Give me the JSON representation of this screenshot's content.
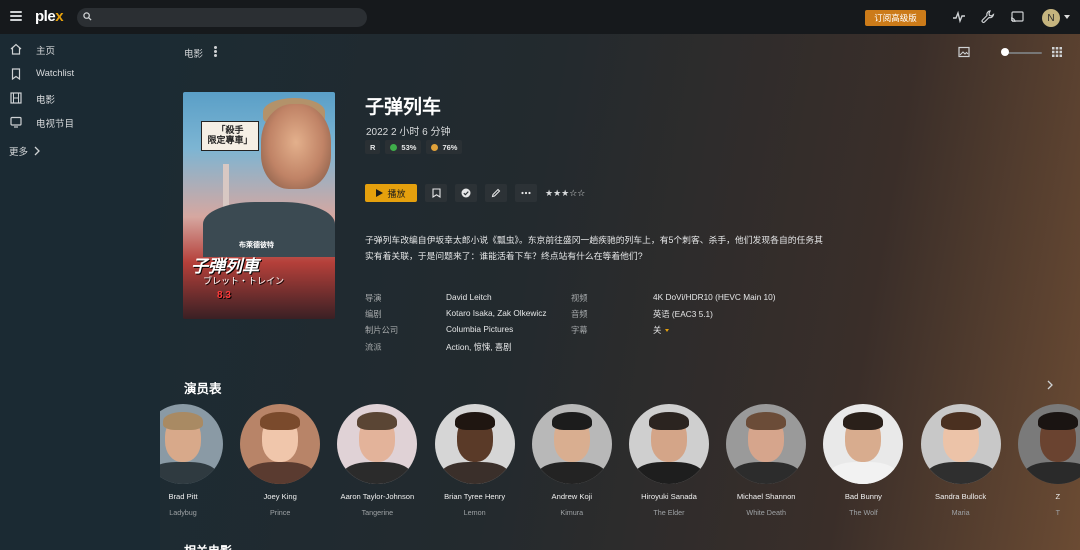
{
  "topbar": {
    "logo_text": "ple",
    "logo_x": "x",
    "search_placeholder": "",
    "upgrade_label": "订阅高级版",
    "avatar_initial": "N",
    "icons": [
      "menu-icon",
      "search-icon",
      "activity-icon",
      "wrench-icon",
      "cast-icon"
    ]
  },
  "sidebar": {
    "items": [
      {
        "label": "主页",
        "icon": "home-icon"
      },
      {
        "label": "Watchlist",
        "icon": "bookmark-icon"
      },
      {
        "label": "电影",
        "icon": "film-icon"
      },
      {
        "label": "电视节目",
        "icon": "tv-icon"
      }
    ],
    "more_label": "更多"
  },
  "main": {
    "breadcrumb": "电影",
    "movie": {
      "title": "子弹列车",
      "meta": "2022  2 小时 6 分钟",
      "content_rating": "R",
      "tomato_score": "53%",
      "audience_score": "76%",
      "play_label": "播放",
      "stars": "★★★☆☆",
      "summary": "子弹列车改编自伊坂幸太郎小说《瓢虫》。东京前往盛冈一趟疾驰的列车上，有5个刺客、杀手，他们发现各自的任务其实有着关联，于是问题来了：谁能活着下车？终点站有什么在等着他们?",
      "poster": {
        "bubble": "「殺手\n限定專車」",
        "title": "子弾列車",
        "subtitle": "ブレット・トレイン",
        "date": "8.3",
        "actor": "布萊德彼特"
      }
    },
    "details": {
      "director_label": "导演",
      "director": "David Leitch",
      "writer_label": "编剧",
      "writer": "Kotaro Isaka, Zak Olkewicz",
      "studio_label": "制片公司",
      "studio": "Columbia Pictures",
      "genre_label": "流派",
      "genre": "Action, 惊悚, 喜剧",
      "video_label": "视频",
      "video": "4K DoVi/HDR10 (HEVC Main 10)",
      "audio_label": "音频",
      "audio": "英语 (EAC3 5.1)",
      "subtitle_label": "字幕",
      "subtitle": "关"
    },
    "cast_title": "演员表",
    "cast": [
      {
        "name": "Brad Pitt",
        "role": "Ladybug",
        "skin": "#d8a98a",
        "hair": "#a98a63",
        "shirt": "#2f3a40",
        "bg": "#8a9aa5"
      },
      {
        "name": "Joey King",
        "role": "Prince",
        "skin": "#f0c6ab",
        "hair": "#7a4a2c",
        "shirt": "#5a3b30",
        "bg": "#b88468"
      },
      {
        "name": "Aaron Taylor-Johnson",
        "role": "Tangerine",
        "skin": "#e3b39a",
        "hair": "#5a4534",
        "shirt": "#2b2b2b",
        "bg": "#e0d2d6"
      },
      {
        "name": "Brian Tyree Henry",
        "role": "Lemon",
        "skin": "#5a3a28",
        "hair": "#1f1611",
        "shirt": "#3a2f2a",
        "bg": "#d6d6d6"
      },
      {
        "name": "Andrew Koji",
        "role": "Kimura",
        "skin": "#d9ae90",
        "hair": "#1c1c1c",
        "shirt": "#232323",
        "bg": "#b8b8b8"
      },
      {
        "name": "Hiroyuki Sanada",
        "role": "The Elder",
        "skin": "#d4a588",
        "hair": "#2b2420",
        "shirt": "#1e1e1e",
        "bg": "#cfcfcf"
      },
      {
        "name": "Michael Shannon",
        "role": "White Death",
        "skin": "#d6a58c",
        "hair": "#6b4c38",
        "shirt": "#2c2c2c",
        "bg": "#9a9a9a"
      },
      {
        "name": "Bad Bunny",
        "role": "The Wolf",
        "skin": "#d8ac8e",
        "hair": "#2a201a",
        "shirt": "#f2f2f2",
        "bg": "#e9e9e9"
      },
      {
        "name": "Sandra Bullock",
        "role": "Maria",
        "skin": "#ecc3a8",
        "hair": "#4a3020",
        "shirt": "#2f2f2f",
        "bg": "#c8c8c8"
      },
      {
        "name": "Z",
        "role": "T",
        "skin": "#6a4330",
        "hair": "#1a1412",
        "shirt": "#2a2a2a",
        "bg": "#7a7a7a"
      }
    ],
    "more_title": "相关电影"
  },
  "colors": {
    "accent": "#e5a00d",
    "upgrade": "#cc7b19",
    "sidebar_bg": "#1b2a33",
    "topbar_bg": "#16191c"
  }
}
